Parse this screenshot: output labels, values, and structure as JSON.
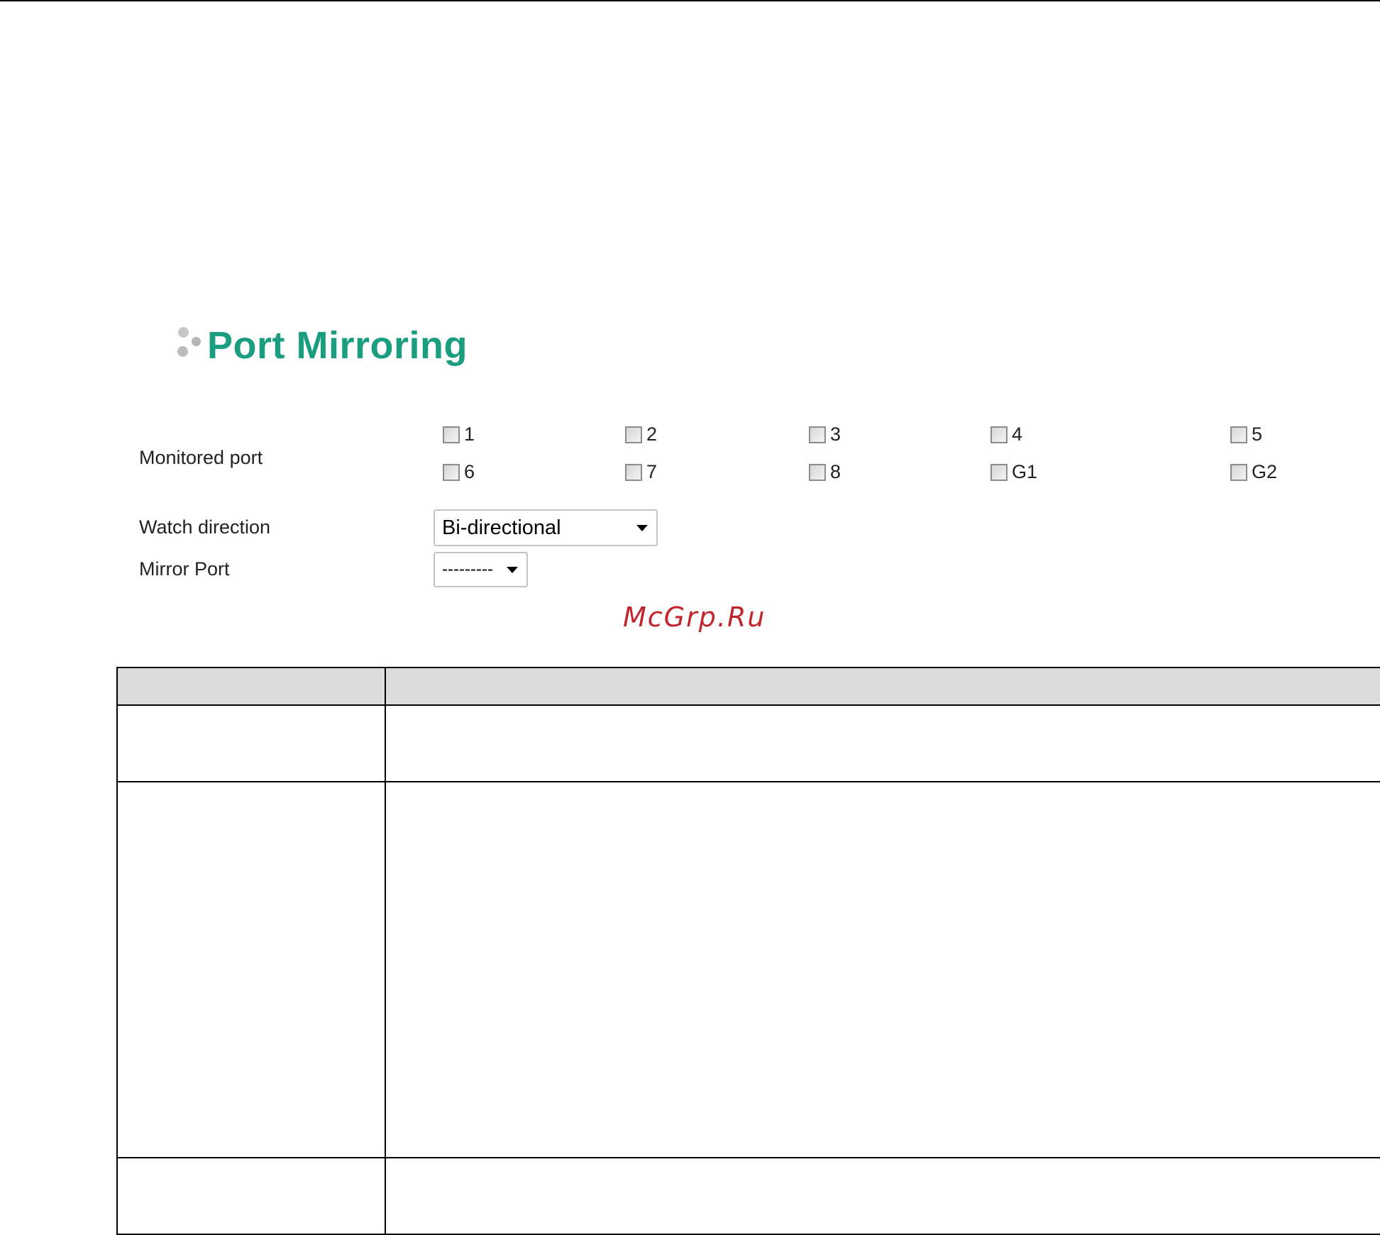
{
  "page": {
    "title": "Port Mirroring"
  },
  "form": {
    "monitored_port": {
      "label": "Monitored port",
      "ports": [
        {
          "label": "1",
          "checked": false
        },
        {
          "label": "2",
          "checked": false
        },
        {
          "label": "3",
          "checked": false
        },
        {
          "label": "4",
          "checked": false
        },
        {
          "label": "5",
          "checked": false
        },
        {
          "label": "6",
          "checked": false
        },
        {
          "label": "7",
          "checked": false
        },
        {
          "label": "8",
          "checked": false
        },
        {
          "label": "G1",
          "checked": false
        },
        {
          "label": "G2",
          "checked": false
        }
      ]
    },
    "watch_direction": {
      "label": "Watch direction",
      "value": "Bi-directional"
    },
    "mirror_port": {
      "label": "Mirror Port",
      "value": "---------"
    }
  },
  "watermark": "McGrp.Ru",
  "colors": {
    "title_green": "#1a9e7f",
    "table_header_gray": "#dcdcdc",
    "watermark_red": "#c0262d"
  }
}
